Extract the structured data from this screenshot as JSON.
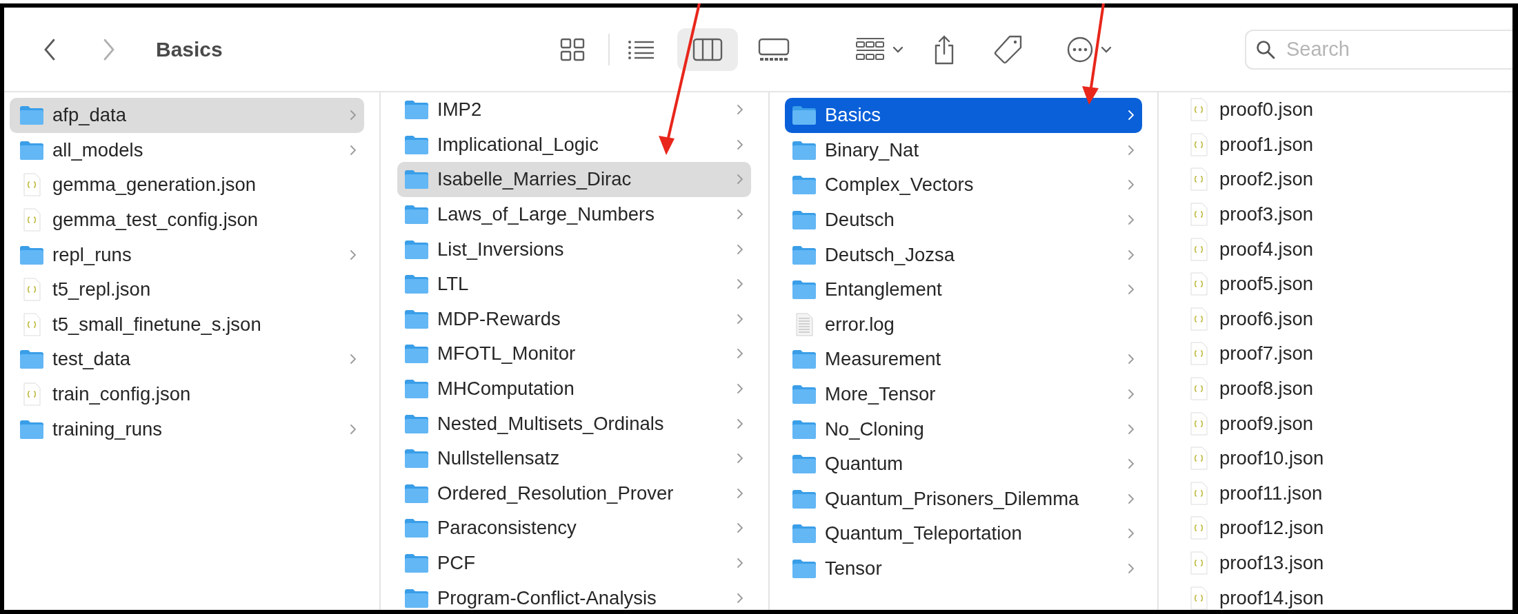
{
  "window": {
    "title": "Basics"
  },
  "toolbar": {
    "view_modes": [
      {
        "kind": "icons",
        "selected": false
      },
      {
        "kind": "list",
        "selected": false
      },
      {
        "kind": "columns",
        "selected": true
      },
      {
        "kind": "gallery",
        "selected": false
      }
    ],
    "search": {
      "placeholder": "Search"
    }
  },
  "columns": [
    {
      "focused": false,
      "items": [
        {
          "name": "afp_data",
          "kind": "folder",
          "selected": true
        },
        {
          "name": "all_models",
          "kind": "folder",
          "selected": false
        },
        {
          "name": "gemma_generation.json",
          "kind": "json",
          "selected": false
        },
        {
          "name": "gemma_test_config.json",
          "kind": "json",
          "selected": false
        },
        {
          "name": "repl_runs",
          "kind": "folder",
          "selected": false
        },
        {
          "name": "t5_repl.json",
          "kind": "json",
          "selected": false
        },
        {
          "name": "t5_small_finetune_s.json",
          "kind": "json",
          "selected": false
        },
        {
          "name": "test_data",
          "kind": "folder",
          "selected": false
        },
        {
          "name": "train_config.json",
          "kind": "json",
          "selected": false
        },
        {
          "name": "training_runs",
          "kind": "folder",
          "selected": false
        }
      ]
    },
    {
      "focused": false,
      "items": [
        {
          "name": "IMP2",
          "kind": "folder",
          "selected": false
        },
        {
          "name": "Implicational_Logic",
          "kind": "folder",
          "selected": false
        },
        {
          "name": "Isabelle_Marries_Dirac",
          "kind": "folder",
          "selected": true
        },
        {
          "name": "Laws_of_Large_Numbers",
          "kind": "folder",
          "selected": false
        },
        {
          "name": "List_Inversions",
          "kind": "folder",
          "selected": false
        },
        {
          "name": "LTL",
          "kind": "folder",
          "selected": false
        },
        {
          "name": "MDP-Rewards",
          "kind": "folder",
          "selected": false
        },
        {
          "name": "MFOTL_Monitor",
          "kind": "folder",
          "selected": false
        },
        {
          "name": "MHComputation",
          "kind": "folder",
          "selected": false
        },
        {
          "name": "Nested_Multisets_Ordinals",
          "kind": "folder",
          "selected": false
        },
        {
          "name": "Nullstellensatz",
          "kind": "folder",
          "selected": false
        },
        {
          "name": "Ordered_Resolution_Prover",
          "kind": "folder",
          "selected": false
        },
        {
          "name": "Paraconsistency",
          "kind": "folder",
          "selected": false
        },
        {
          "name": "PCF",
          "kind": "folder",
          "selected": false
        },
        {
          "name": "Program-Conflict-Analysis",
          "kind": "folder",
          "selected": false
        }
      ]
    },
    {
      "focused": true,
      "items": [
        {
          "name": "Basics",
          "kind": "folder",
          "selected": true
        },
        {
          "name": "Binary_Nat",
          "kind": "folder",
          "selected": false
        },
        {
          "name": "Complex_Vectors",
          "kind": "folder",
          "selected": false
        },
        {
          "name": "Deutsch",
          "kind": "folder",
          "selected": false
        },
        {
          "name": "Deutsch_Jozsa",
          "kind": "folder",
          "selected": false
        },
        {
          "name": "Entanglement",
          "kind": "folder",
          "selected": false
        },
        {
          "name": "error.log",
          "kind": "log",
          "selected": false
        },
        {
          "name": "Measurement",
          "kind": "folder",
          "selected": false
        },
        {
          "name": "More_Tensor",
          "kind": "folder",
          "selected": false
        },
        {
          "name": "No_Cloning",
          "kind": "folder",
          "selected": false
        },
        {
          "name": "Quantum",
          "kind": "folder",
          "selected": false
        },
        {
          "name": "Quantum_Prisoners_Dilemma",
          "kind": "folder",
          "selected": false
        },
        {
          "name": "Quantum_Teleportation",
          "kind": "folder",
          "selected": false
        },
        {
          "name": "Tensor",
          "kind": "folder",
          "selected": false
        }
      ]
    },
    {
      "focused": false,
      "items": [
        {
          "name": "proof0.json",
          "kind": "json",
          "selected": false
        },
        {
          "name": "proof1.json",
          "kind": "json",
          "selected": false
        },
        {
          "name": "proof2.json",
          "kind": "json",
          "selected": false
        },
        {
          "name": "proof3.json",
          "kind": "json",
          "selected": false
        },
        {
          "name": "proof4.json",
          "kind": "json",
          "selected": false
        },
        {
          "name": "proof5.json",
          "kind": "json",
          "selected": false
        },
        {
          "name": "proof6.json",
          "kind": "json",
          "selected": false
        },
        {
          "name": "proof7.json",
          "kind": "json",
          "selected": false
        },
        {
          "name": "proof8.json",
          "kind": "json",
          "selected": false
        },
        {
          "name": "proof9.json",
          "kind": "json",
          "selected": false
        },
        {
          "name": "proof10.json",
          "kind": "json",
          "selected": false
        },
        {
          "name": "proof11.json",
          "kind": "json",
          "selected": false
        },
        {
          "name": "proof12.json",
          "kind": "json",
          "selected": false
        },
        {
          "name": "proof13.json",
          "kind": "json",
          "selected": false
        },
        {
          "name": "proof14.json",
          "kind": "json",
          "selected": false
        }
      ]
    }
  ]
}
